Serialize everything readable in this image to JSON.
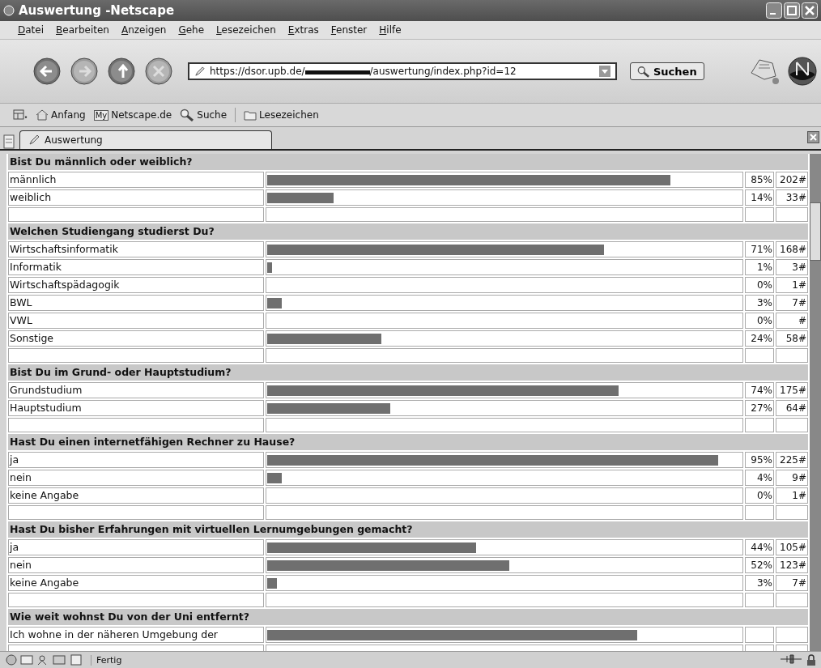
{
  "window": {
    "title": "Auswertung -Netscape"
  },
  "menu": [
    "Datei",
    "Bearbeiten",
    "Anzeigen",
    "Gehe",
    "Lesezeichen",
    "Extras",
    "Fenster",
    "Hilfe"
  ],
  "address": {
    "url_start": "https://dsor.upb.de/",
    "url_end": "/auswertung/index.php?id=12"
  },
  "search_button": "Suchen",
  "personal_toolbar": [
    {
      "kind": "home",
      "label": "Anfang"
    },
    {
      "kind": "my",
      "badge": "My",
      "label": "Netscape.de"
    },
    {
      "kind": "search",
      "label": "Suche"
    },
    {
      "kind": "folder",
      "label": "Lesezeichen"
    }
  ],
  "tabs": [
    {
      "label": "Auswertung",
      "selected": true
    }
  ],
  "sections": [
    {
      "question": "Bist Du männlich oder weiblich?",
      "answers": [
        {
          "label": "männlich",
          "level": 0.85,
          "percent": "85%",
          "count": "202#"
        },
        {
          "label": "weiblich",
          "level": 0.14,
          "percent": "14%",
          "count": "33#"
        }
      ]
    },
    {
      "question": "Welchen Studiengang studierst Du?",
      "answers": [
        {
          "label": "Wirtschaftsinformatik",
          "level": 0.71,
          "percent": "71%",
          "count": "168#"
        },
        {
          "label": "Informatik",
          "level": 0.01,
          "percent": "1%",
          "count": "3#"
        },
        {
          "label": "Wirtschaftspädagogik",
          "level": 0,
          "percent": "0%",
          "count": "1#"
        },
        {
          "label": "BWL",
          "level": 0.03,
          "percent": "3%",
          "count": "7#"
        },
        {
          "label": "VWL",
          "level": 0,
          "percent": "0%",
          "count": "#"
        },
        {
          "label": "Sonstige",
          "level": 0.24,
          "percent": "24%",
          "count": "58#"
        }
      ]
    },
    {
      "question": "Bist Du im Grund- oder Hauptstudium?",
      "answers": [
        {
          "label": "Grundstudium",
          "level": 0.74,
          "percent": "74%",
          "count": "175#"
        },
        {
          "label": "Hauptstudium",
          "level": 0.26,
          "percent": "27%",
          "count": "64#"
        }
      ]
    },
    {
      "question": "Hast Du einen internetfähigen Rechner zu Hause?",
      "answers": [
        {
          "label": "ja",
          "level": 0.95,
          "percent": "95%",
          "count": "225#"
        },
        {
          "label": "nein",
          "level": 0.03,
          "percent": "4%",
          "count": "9#"
        },
        {
          "label": "keine Angabe",
          "level": 0,
          "percent": "0%",
          "count": "1#"
        }
      ]
    },
    {
      "question": "Hast Du bisher Erfahrungen mit virtuellen Lernumgebungen gemacht?",
      "answers": [
        {
          "label": "ja",
          "level": 0.44,
          "percent": "44%",
          "count": "105#"
        },
        {
          "label": "nein",
          "level": 0.51,
          "percent": "52%",
          "count": "123#"
        },
        {
          "label": "keine Angabe",
          "level": 0.02,
          "percent": "3%",
          "count": "7#"
        }
      ]
    },
    {
      "question": "Wie weit wohnst Du von der Uni entfernt?",
      "answers": [
        {
          "label": "Ich wohne in der näheren Umgebung der",
          "level": 0.78
        }
      ]
    }
  ],
  "status_bar": {
    "text": "Fertig"
  }
}
